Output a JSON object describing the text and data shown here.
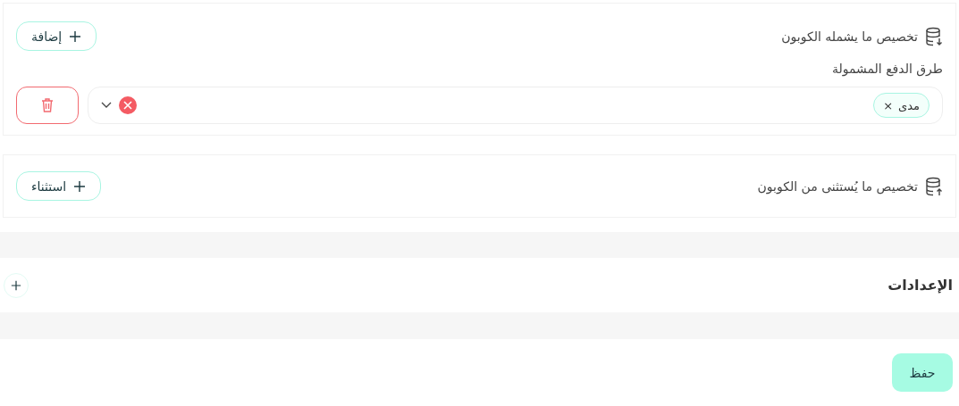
{
  "include_card": {
    "title": "تخصيص ما يشمله الكوبون",
    "add_button": "إضافة",
    "field_label": "طرق الدفع المشمولة",
    "tags": [
      {
        "label": "مدى"
      }
    ],
    "remove_tag_glyph": "×"
  },
  "exclude_card": {
    "title": "تخصيص ما يُستثنى من الكوبون",
    "add_button": "استثناء"
  },
  "settings": {
    "title": "الإعدادات",
    "expanded": false
  },
  "save_button": "حفظ"
}
